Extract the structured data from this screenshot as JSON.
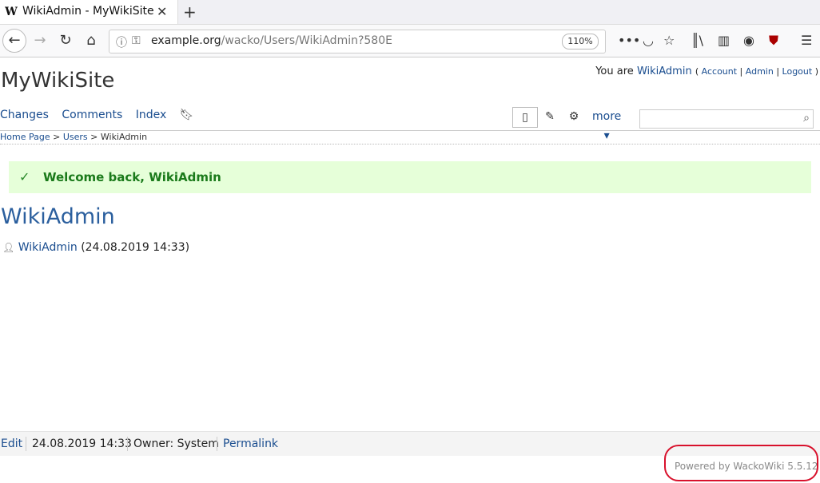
{
  "browser": {
    "tab_title": "WikiAdmin - MyWikiSite",
    "tab_favicon": "W",
    "url_host": "example.org",
    "url_path": "/wacko/Users/WikiAdmin?580E",
    "zoom": "110%"
  },
  "site": {
    "title": "MyWikiSite",
    "user_prefix": "You are",
    "user_name": "WikiAdmin",
    "account": "Account",
    "admin": "Admin",
    "logout": "Logout"
  },
  "menu": {
    "changes": "Changes",
    "comments": "Comments",
    "index": "Index",
    "more": "more"
  },
  "breadcrumb": {
    "home": "Home Page",
    "users": "Users",
    "current": "WikiAdmin",
    "sep": ">"
  },
  "notice": {
    "text": "Welcome back, WikiAdmin"
  },
  "page": {
    "heading": "WikiAdmin",
    "owner": "WikiAdmin",
    "date": "(24.08.2019 14:33)"
  },
  "footer": {
    "edit": "Edit",
    "date": "24.08.2019 14:33",
    "owner": "Owner: System",
    "permalink": "Permalink",
    "powered": "Powered by WackoWiki 5.5.12"
  },
  "colors": {
    "link": "#1a4d8f",
    "heading": "#2b5f9e",
    "notice_bg": "#e6ffd9",
    "highlight": "#d8112c"
  }
}
